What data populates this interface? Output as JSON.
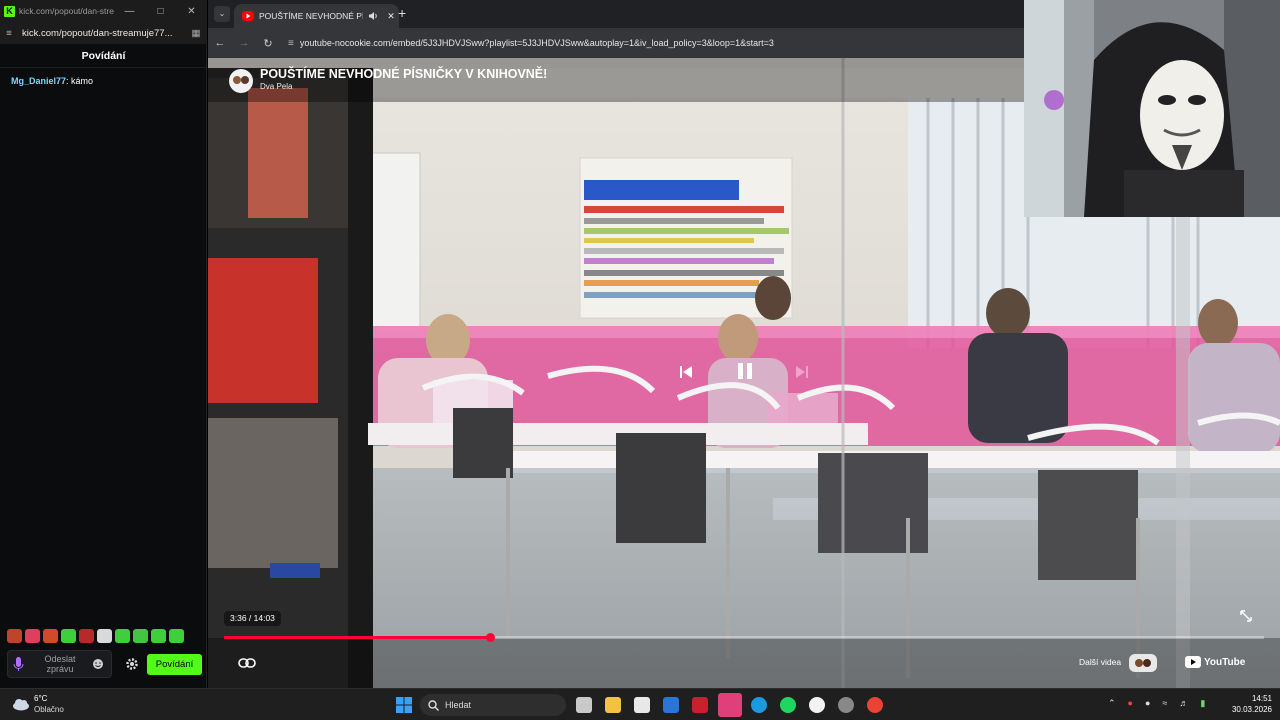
{
  "kick_window": {
    "title": "kick.com/popout/dan-stre...",
    "url": "kick.com/popout/dan-streamuje77...",
    "chat_header": "Povídání",
    "messages": [
      {
        "user": "Mg_Daniel77",
        "text": " kámo"
      }
    ],
    "input_placeholder": "Odeslat zprávu",
    "send_label": "Povídání",
    "accent": "#53fc18"
  },
  "browser": {
    "tab_title": "POUŠTÍME NEVHODNÉ PÍSNI",
    "url": "youtube-nocookie.com/embed/5J3JHDVJSww?playlist=5J3JHDVJSww&autoplay=1&iv_load_policy=3&loop=1&start=3"
  },
  "video": {
    "title": "POUŠTÍME NEVHODNÉ PÍSNIČKY V KNIHOVNĚ!",
    "channel": "Dva Pela",
    "time": "3:36 / 14:03",
    "progress": 0.256,
    "more_videos": "Další videa",
    "youtube": "YouTube",
    "progress_color": "#ff0033"
  },
  "taskbar": {
    "weather_temp": "6°C",
    "weather_desc": "Oblačno",
    "search": "Hledat",
    "time": "14:51",
    "date": "30.03.2026"
  }
}
